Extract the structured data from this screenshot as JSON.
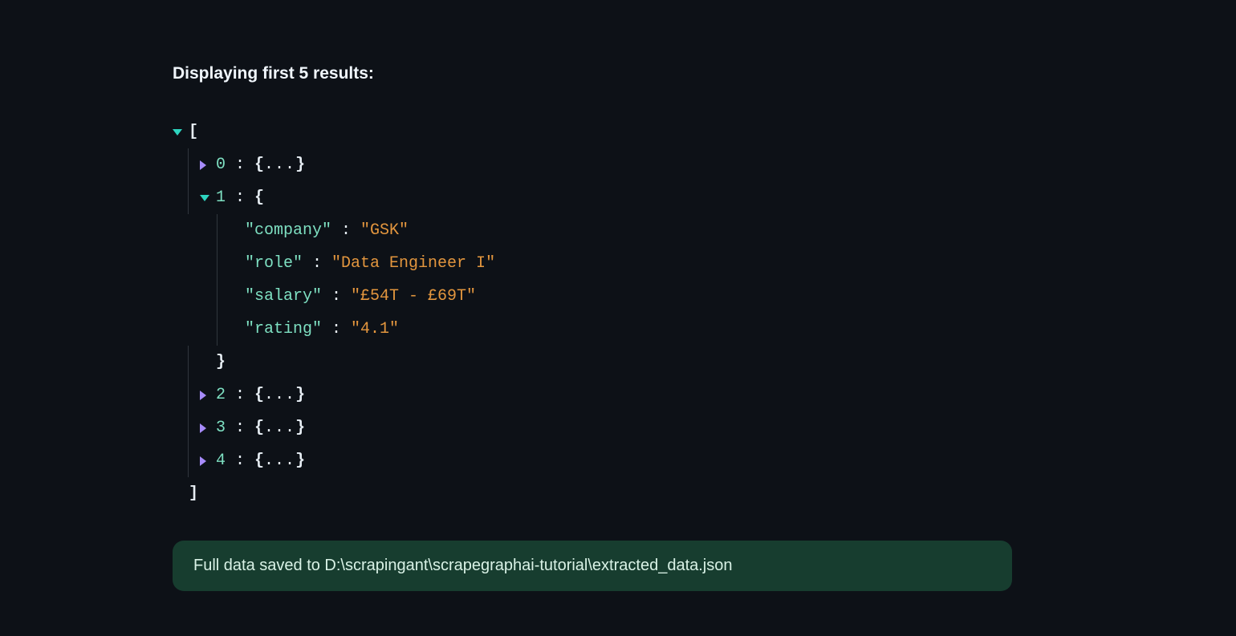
{
  "heading": "Displaying first 5 results:",
  "open_bracket": "[",
  "close_bracket": "]",
  "ellipsis": "...",
  "brace_open": "{",
  "brace_close": "}",
  "collapsed": [
    {
      "index": "0"
    },
    {
      "index": "2"
    },
    {
      "index": "3"
    },
    {
      "index": "4"
    }
  ],
  "expanded": {
    "index": "1",
    "entries": [
      {
        "key": "\"company\"",
        "value": "\"GSK\""
      },
      {
        "key": "\"role\"",
        "value": "\"Data Engineer I\""
      },
      {
        "key": "\"salary\"",
        "value": "\"£54T - £69T\""
      },
      {
        "key": "\"rating\"",
        "value": "\"4.1\""
      }
    ]
  },
  "status_message": "Full data saved to D:\\scrapingant\\scrapegraphai-tutorial\\extracted_data.json"
}
